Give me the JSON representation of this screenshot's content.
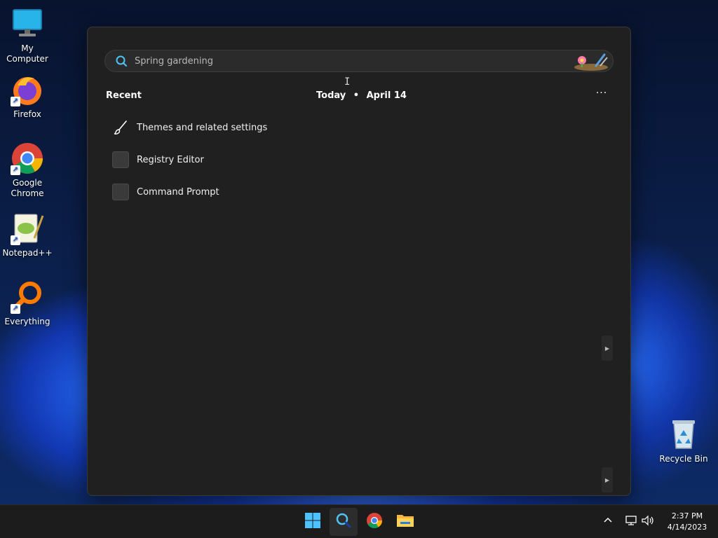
{
  "desktop": {
    "icons": [
      {
        "label": "My Computer"
      },
      {
        "label": "Firefox"
      },
      {
        "label": "Google Chrome"
      },
      {
        "label": "Notepad++"
      },
      {
        "label": "Everything"
      },
      {
        "label": "Recycle Bin"
      }
    ]
  },
  "start_menu": {
    "search": {
      "placeholder": "Spring gardening"
    },
    "recent_header": "Recent",
    "today_header": "Today",
    "today_separator": "•",
    "today_date": "April 14",
    "more_label": "···",
    "recent_items": [
      {
        "label": "Themes and related settings",
        "icon": "paintbrush-icon"
      },
      {
        "label": "Registry Editor",
        "icon": "app-placeholder-icon"
      },
      {
        "label": "Command Prompt",
        "icon": "app-placeholder-icon"
      }
    ]
  },
  "taskbar": {
    "apps": [
      "start-icon",
      "search-icon",
      "chrome-icon",
      "file-explorer-icon"
    ],
    "clock": {
      "time": "2:37 PM",
      "date": "4/14/2023"
    }
  },
  "colors": {
    "panel_bg": "#202020",
    "taskbar_bg": "#1c1c1c",
    "accent": "#1a5fd6"
  }
}
